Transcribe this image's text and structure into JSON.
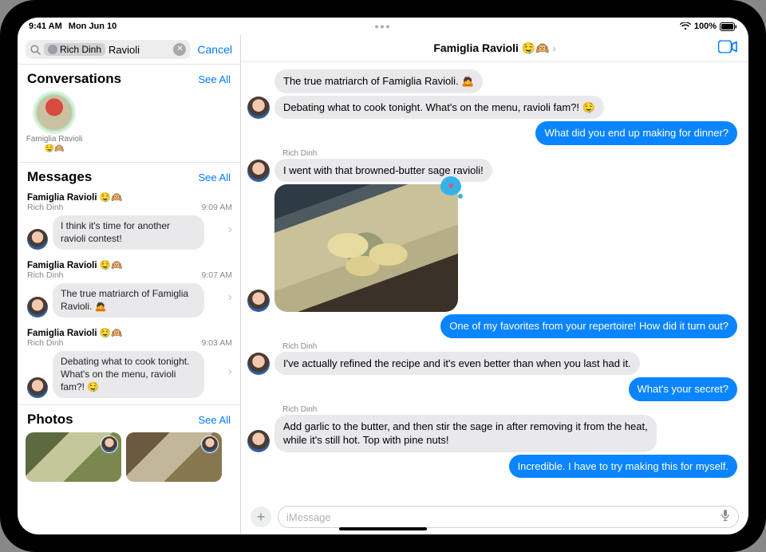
{
  "status": {
    "time": "9:41 AM",
    "date": "Mon Jun 10",
    "battery_pct": "100%"
  },
  "search": {
    "token_name": "Rich Dinh",
    "text": "Ravioli",
    "cancel": "Cancel"
  },
  "sections": {
    "conversations": {
      "title": "Conversations",
      "see_all": "See All"
    },
    "messages": {
      "title": "Messages",
      "see_all": "See All"
    },
    "photos": {
      "title": "Photos",
      "see_all": "See All"
    }
  },
  "conversation_results": [
    {
      "name": "Famiglia Ravioli 🤤🙉"
    }
  ],
  "message_results": [
    {
      "chat": "Famiglia Ravioli 🤤🙉",
      "sender": "Rich Dinh",
      "time": "9:09 AM",
      "text": "I think it's time for another ravioli contest!"
    },
    {
      "chat": "Famiglia Ravioli 🤤🙉",
      "sender": "Rich Dinh",
      "time": "9:07 AM",
      "text": "The true matriarch of Famiglia Ravioli. 🙇"
    },
    {
      "chat": "Famiglia Ravioli 🤤🙉",
      "sender": "Rich Dinh",
      "time": "9:03 AM",
      "text": "Debating what to cook tonight. What's on the menu, ravioli fam?! 🤤"
    }
  ],
  "conversation": {
    "title": "Famiglia Ravioli 🤤🙉",
    "thread": [
      {
        "dir": "in",
        "sender": "",
        "text": "The true matriarch of Famiglia Ravioli. 🙇",
        "show_avatar": false
      },
      {
        "dir": "in",
        "sender": "",
        "text": "Debating what to cook tonight. What's on the menu, ravioli fam?! 🤤",
        "show_avatar": true
      },
      {
        "dir": "out",
        "sender": "",
        "text": "What did you end up making for dinner?"
      },
      {
        "dir": "in",
        "sender": "Rich Dinh",
        "text": "I went with that browned-butter sage ravioli!",
        "show_avatar": true
      },
      {
        "dir": "in_photo",
        "sender": "",
        "show_avatar": true,
        "tapback": "heart"
      },
      {
        "dir": "out",
        "sender": "",
        "text": "One of my favorites from your repertoire! How did it turn out?"
      },
      {
        "dir": "in",
        "sender": "Rich Dinh",
        "text": "I've actually refined the recipe and it's even better than when you last had it.",
        "show_avatar": true
      },
      {
        "dir": "out",
        "sender": "",
        "text": "What's your secret?"
      },
      {
        "dir": "in",
        "sender": "Rich Dinh",
        "text": "Add garlic to the butter, and then stir the sage in after removing it from the heat, while it's still hot. Top with pine nuts!",
        "show_avatar": true
      },
      {
        "dir": "out",
        "sender": "",
        "text": "Incredible. I have to try making this for myself."
      }
    ],
    "compose_placeholder": "iMessage"
  }
}
